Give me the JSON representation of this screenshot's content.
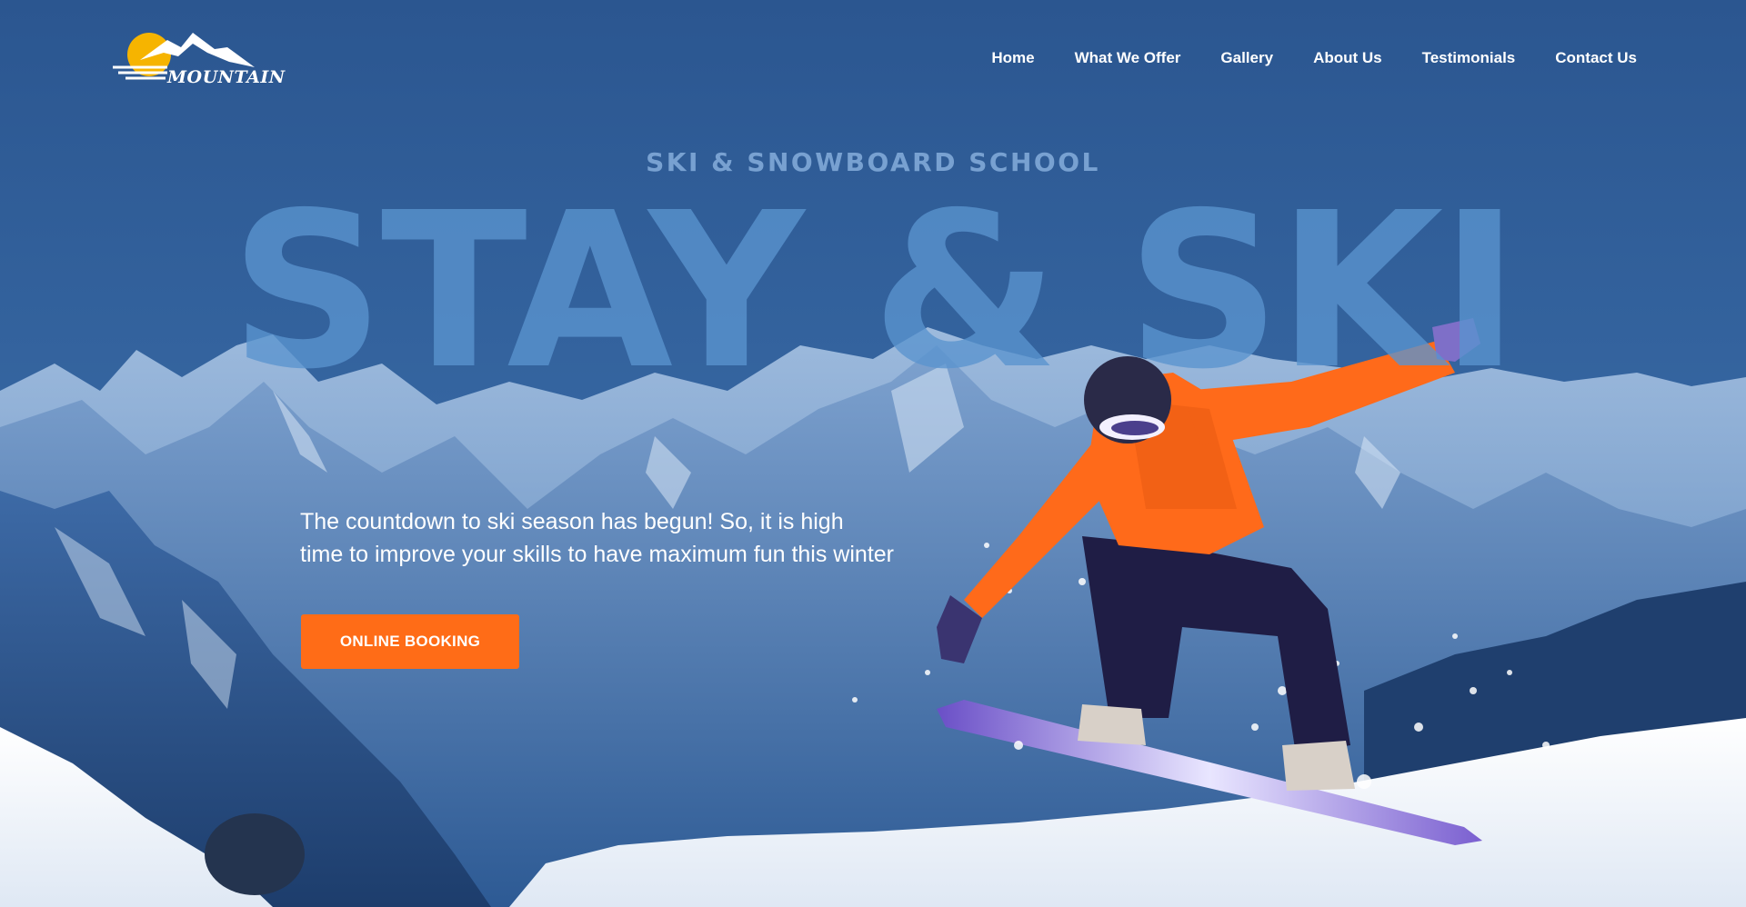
{
  "brand": {
    "logo_text": "MOUNTAIN"
  },
  "nav": {
    "items": [
      {
        "label": "Home"
      },
      {
        "label": "What We Offer"
      },
      {
        "label": "Gallery"
      },
      {
        "label": "About Us"
      },
      {
        "label": "Testimonials"
      },
      {
        "label": "Contact Us"
      }
    ]
  },
  "hero": {
    "kicker": "SKI & SNOWBOARD SCHOOL",
    "title": "STAY & SKI",
    "tagline_line1": "The countdown to ski season has begun! So, it is high",
    "tagline_line2": "time to improve your skills to have maximum fun this winter",
    "cta_label": "ONLINE BOOKING"
  },
  "colors": {
    "sky": "#2f5b93",
    "accent": "#ff6c17",
    "title": "#5a94cf",
    "kicker": "#7fa7d6",
    "jacket": "#ff6a1a",
    "pants": "#1f1d45"
  },
  "icons": {
    "logo": "sun-mountain-logo-icon"
  }
}
